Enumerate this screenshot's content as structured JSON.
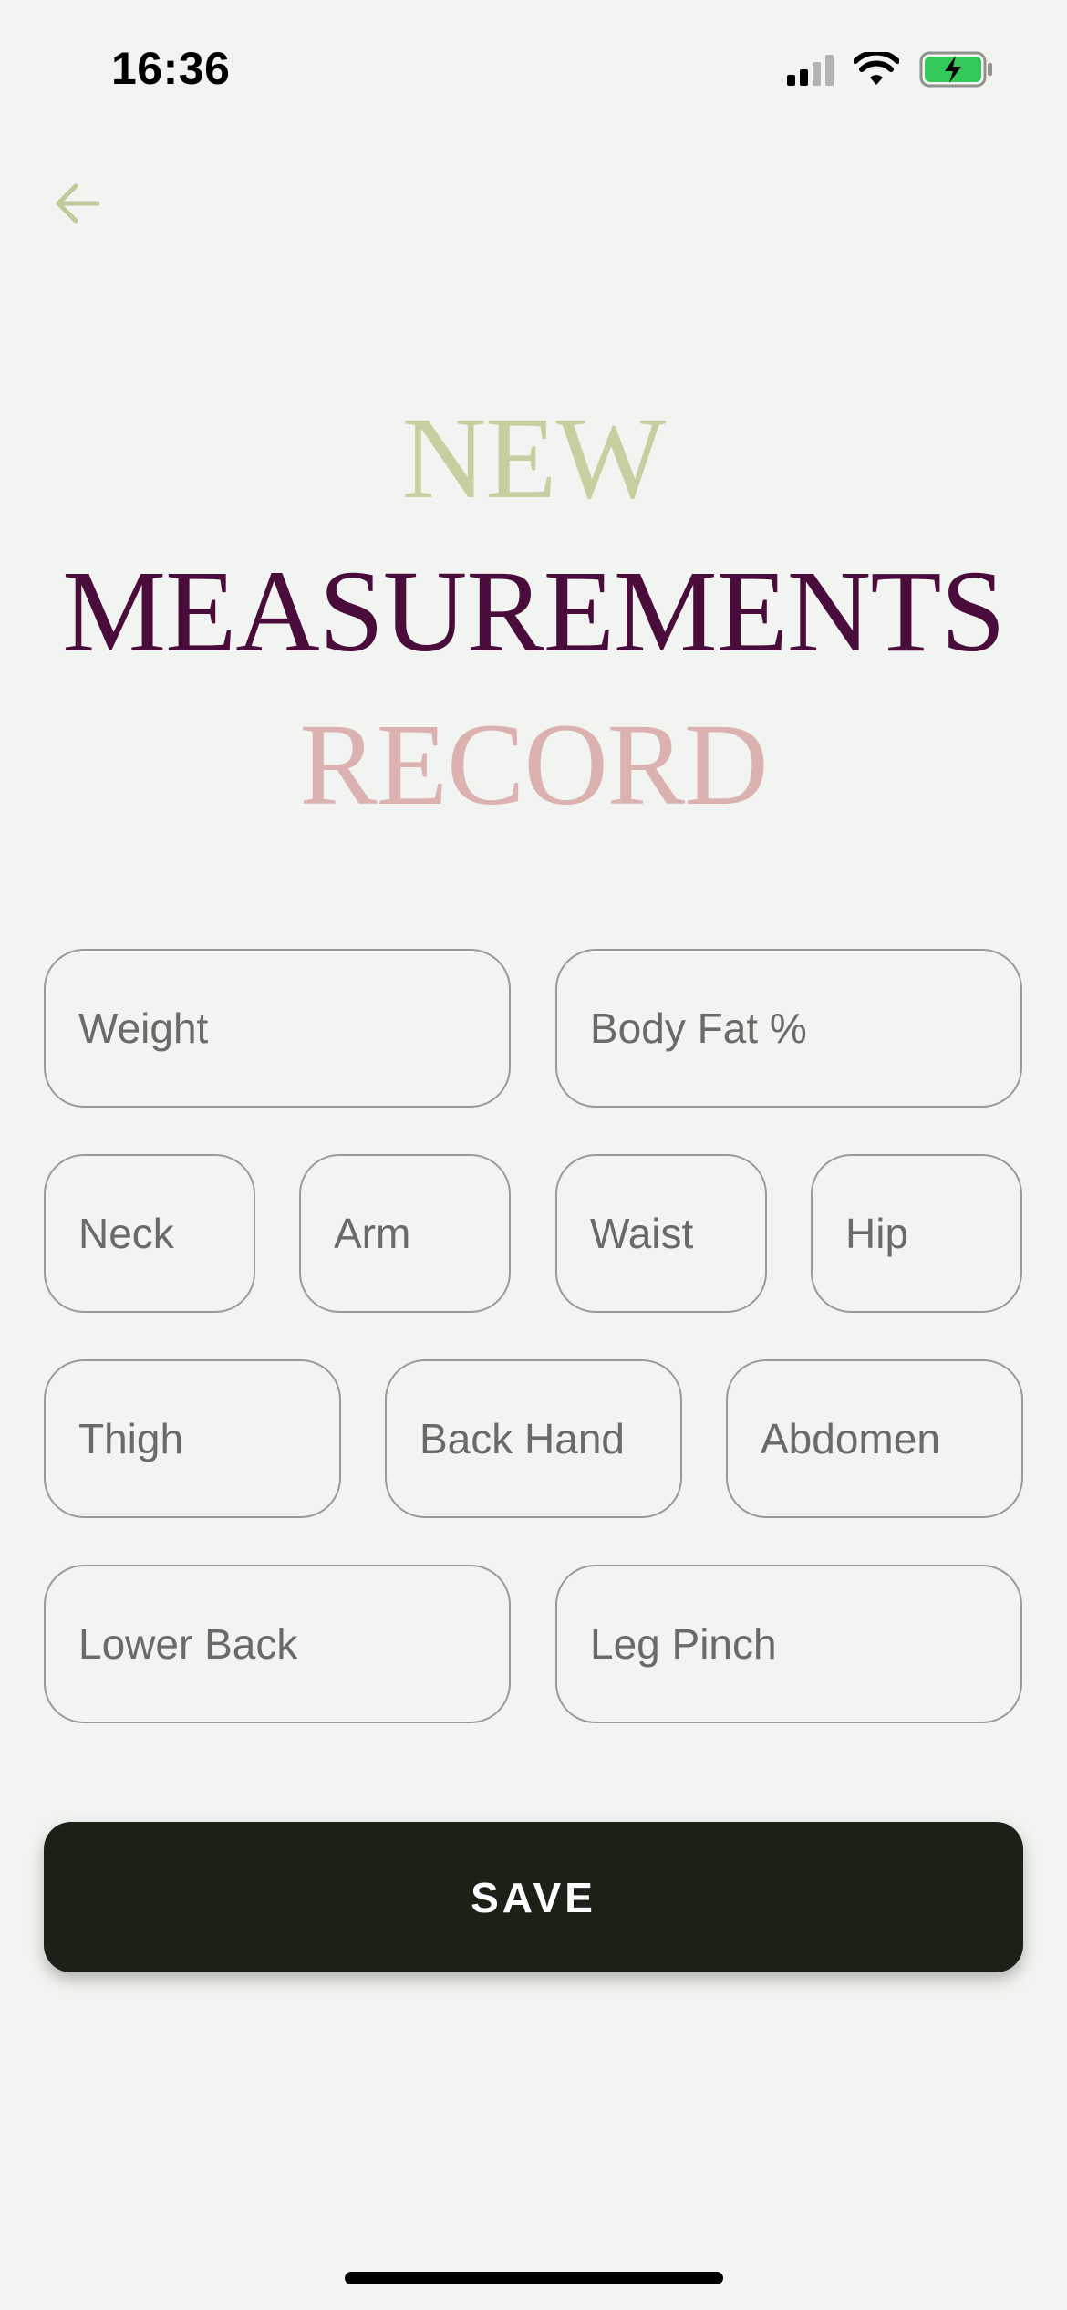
{
  "status_bar": {
    "time": "16:36"
  },
  "colors": {
    "background": "#f2f4f1",
    "title_new": "#c6cf9f",
    "title_measurements": "#4a0d3b",
    "title_record": "#dcb2b1",
    "back_arrow": "#bfc99a",
    "button_bg": "#1b2117",
    "battery_fill": "#34c759"
  },
  "header": {
    "back_icon": "arrow-left-icon"
  },
  "title": {
    "line1": "NEW",
    "line2": "MEASUREMENTS",
    "line3": "RECORD"
  },
  "fields": {
    "weight": "Weight",
    "body_fat": "Body Fat %",
    "neck": "Neck",
    "arm": "Arm",
    "waist": "Waist",
    "hip": "Hip",
    "thigh": "Thigh",
    "back_hand": "Back Hand",
    "abdomen": "Abdomen",
    "lower_back": "Lower Back",
    "leg_pinch": "Leg Pinch"
  },
  "actions": {
    "save_label": "SAVE"
  }
}
